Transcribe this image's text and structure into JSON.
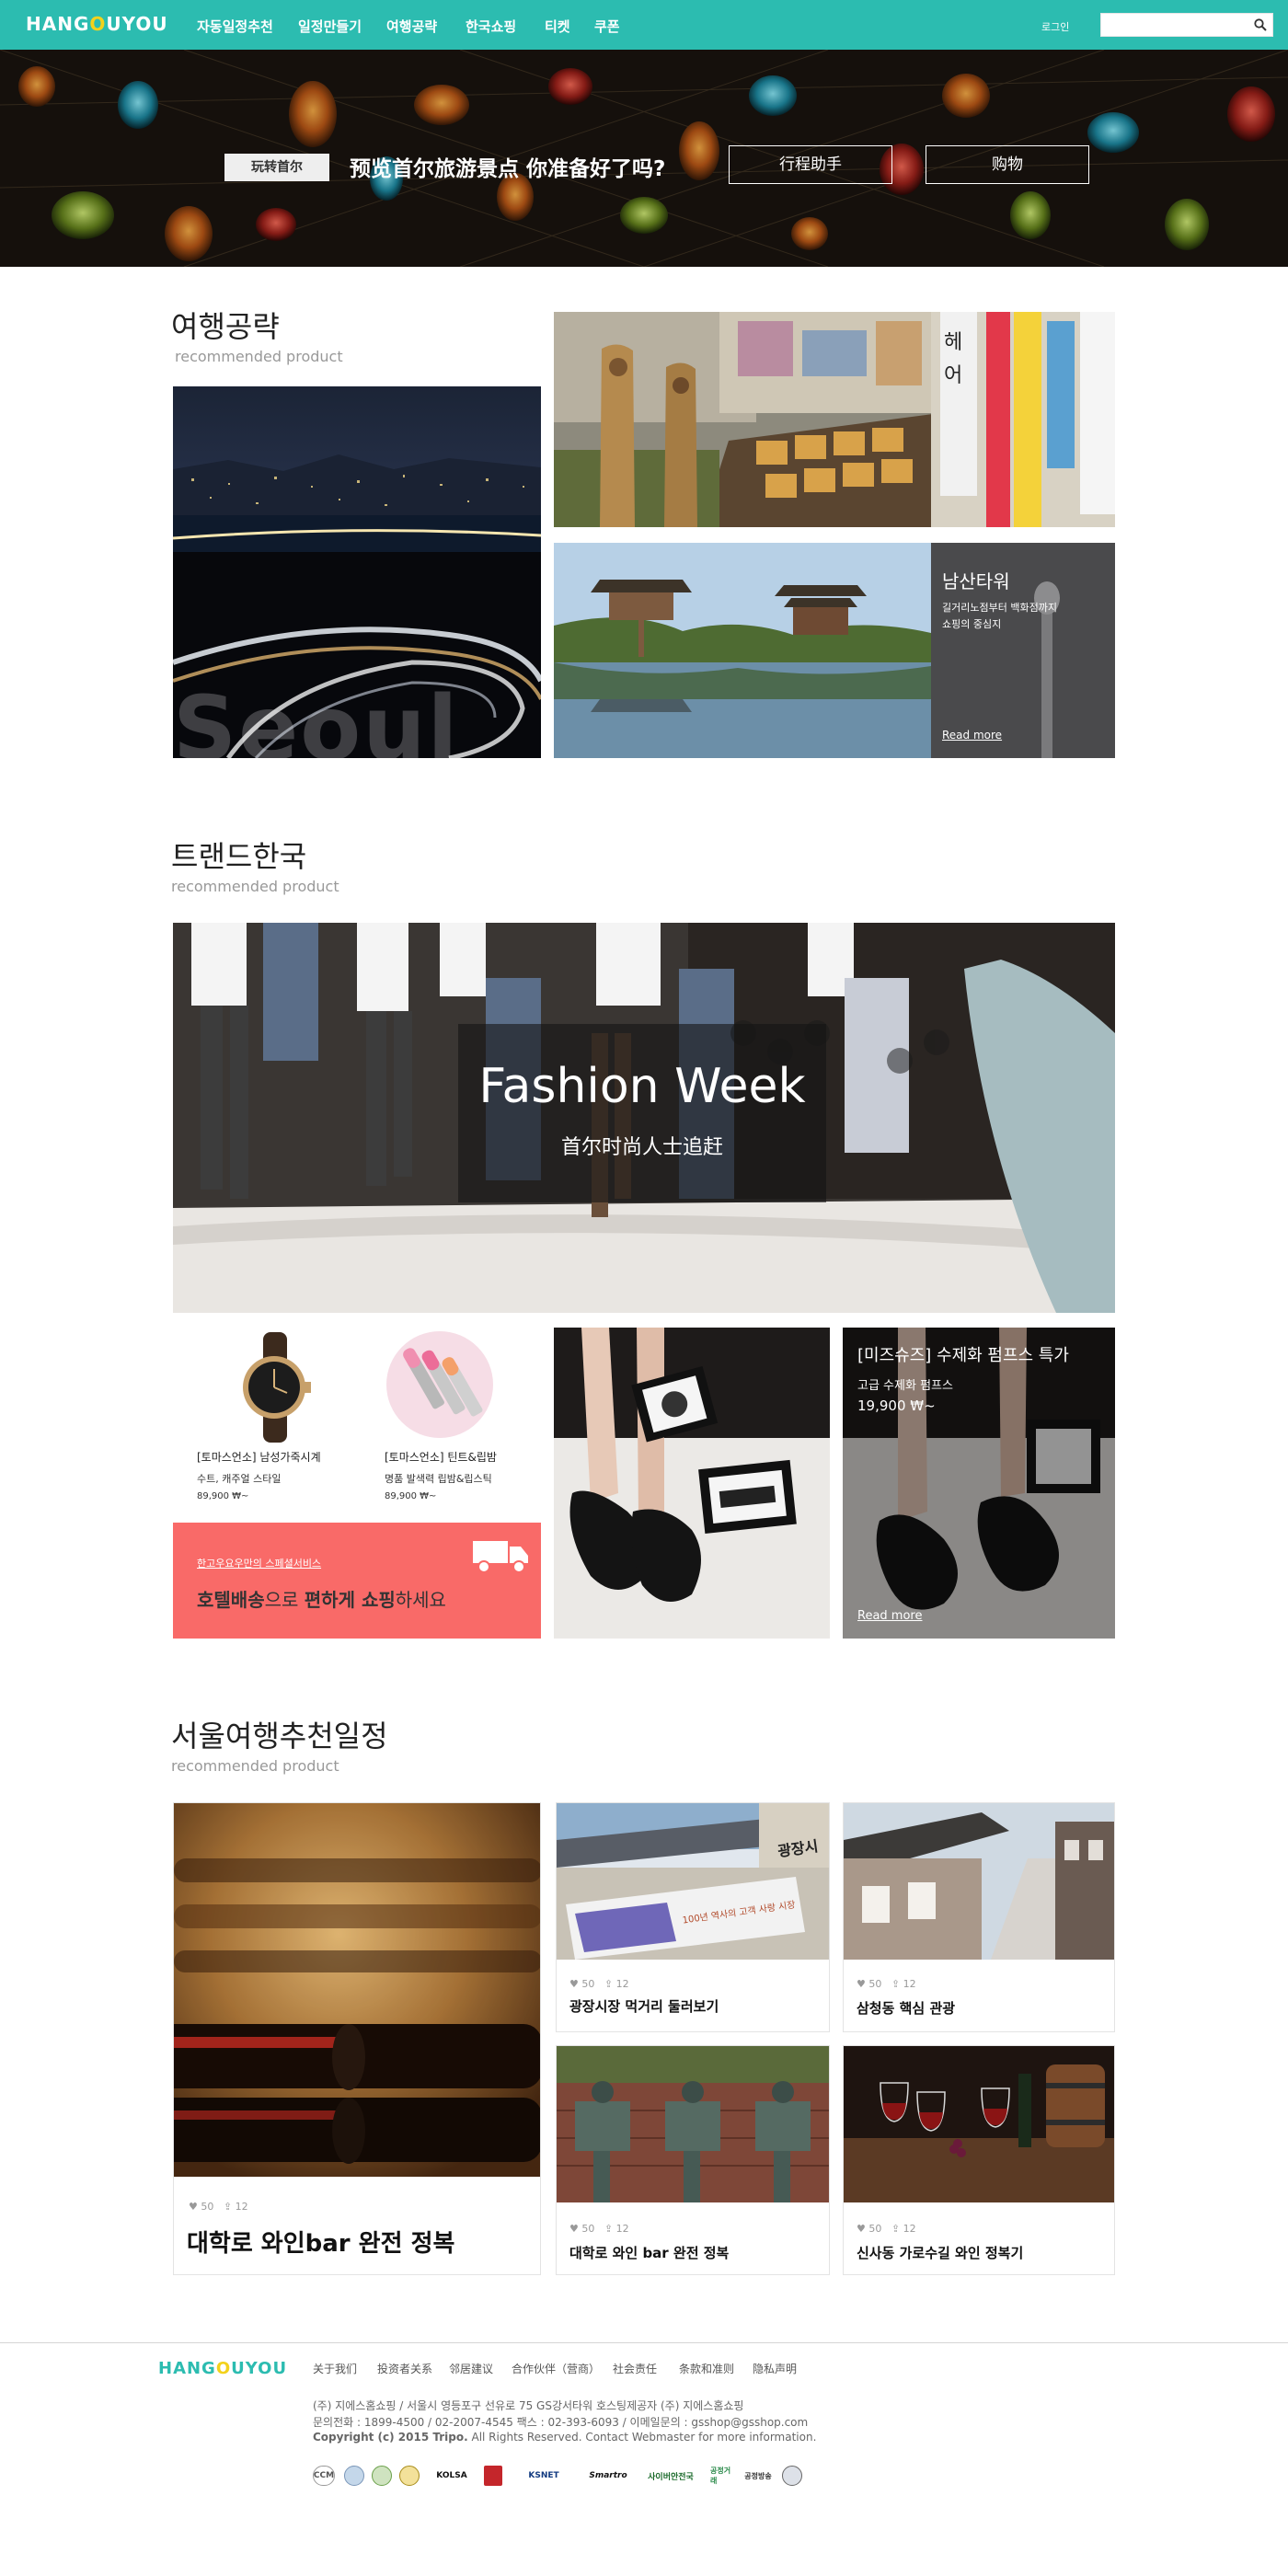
{
  "header": {
    "logo_a": "HANG",
    "logo_b": "O",
    "logo_c": "U",
    "logo_d": "YOU",
    "nav": [
      "자동일정추천",
      "일정만들기",
      "여행공략",
      "한국쇼핑",
      "티켓",
      "쿠폰"
    ],
    "login": "로그인",
    "search_placeholder": ""
  },
  "hero": {
    "tag": "玩转首尔",
    "headline": "预览首尔旅游景点 你准备好了吗?",
    "btn_itinerary": "行程助手",
    "btn_shopping": "购物"
  },
  "travel": {
    "title": "여행공략",
    "subtitle": "recommended product",
    "seoul_watermark": "Seoul",
    "tower_title": "남산타워",
    "tower_desc_1": "길거리노점부터 백화점까지",
    "tower_desc_2": "쇼핑의 중심지",
    "tower_more": "Read more"
  },
  "trend": {
    "title": "트랜드한국",
    "subtitle": "recommended product",
    "banner_title": "Fashion Week",
    "banner_sub": "首尔时尚人士追赶",
    "products": [
      {
        "name": "[토마스언소] 남성가죽시계",
        "desc": "수트, 캐주얼 스타일",
        "price": "89,900 ₩~"
      },
      {
        "name": "[토마스언소] 틴트&립밤",
        "desc": "명품 발색력 립밤&립스틱",
        "price": "89,900 ₩~"
      }
    ],
    "delivery_small": "한고우요우만의 스페셜서비스",
    "delivery_main_1": "호텔배송",
    "delivery_main_2": "으로 ",
    "delivery_main_3": "편하게 쇼핑",
    "delivery_main_4": "하세요",
    "shoe_title": "[미즈슈즈] 수제화 펌프스 특가",
    "shoe_desc": "고급 수제화 펌프스",
    "shoe_price": "19,900 ₩~",
    "shoe_more": "Read more"
  },
  "itinerary": {
    "title": "서울여행추천일정",
    "subtitle": "recommended product",
    "cards": [
      {
        "likes": "50",
        "shares": "12",
        "title": "대학로 와인bar 완전 정복"
      },
      {
        "likes": "50",
        "shares": "12",
        "title": "광장시장 먹거리 둘러보기"
      },
      {
        "likes": "50",
        "shares": "12",
        "title": "삼청동 핵심 관광"
      },
      {
        "likes": "50",
        "shares": "12",
        "title": "대학로 와인 bar 완전 정복"
      },
      {
        "likes": "50",
        "shares": "12",
        "title": "신사동 가로수길 와인 정복기"
      }
    ],
    "market_sign": "광장시",
    "market_banner": "100년 역사의 고객 사랑 시장"
  },
  "footer": {
    "logo_a": "HANG",
    "logo_b": "O",
    "logo_c": "U",
    "logo_d": "YOU",
    "links": [
      "关于我们",
      "投资者关系",
      "邻居建议",
      "合作伙伴（营商）",
      "社会责任",
      "条款和准则",
      "隐私声明"
    ],
    "line1": "(주) 지에스홈쇼핑  / 서울시 영등포구 선유로 75 GS강서타워 호스팅제공자 (주) 지에스홈쇼핑",
    "line2": "문의전화 : 1899-4500 / 02-2007-4545 팩스 : 02-393-6093 / 이메일문의 : gsshop@gsshop.com",
    "line3_bold": "Copyright (c) 2015 Tripo.",
    "line3_rest": " All Rights Reserved. Contact Webmaster for more information.",
    "badges": [
      "CCM",
      "",
      "",
      "",
      "KOLSA",
      "",
      "KSNET",
      "Smartro",
      "사이버안전국",
      "공정거래",
      "공정방송",
      ""
    ]
  },
  "colors": {
    "brand": "#2cbcb0",
    "logo_yellow": "#f3d21b",
    "delivery_red": "#f96a68"
  }
}
